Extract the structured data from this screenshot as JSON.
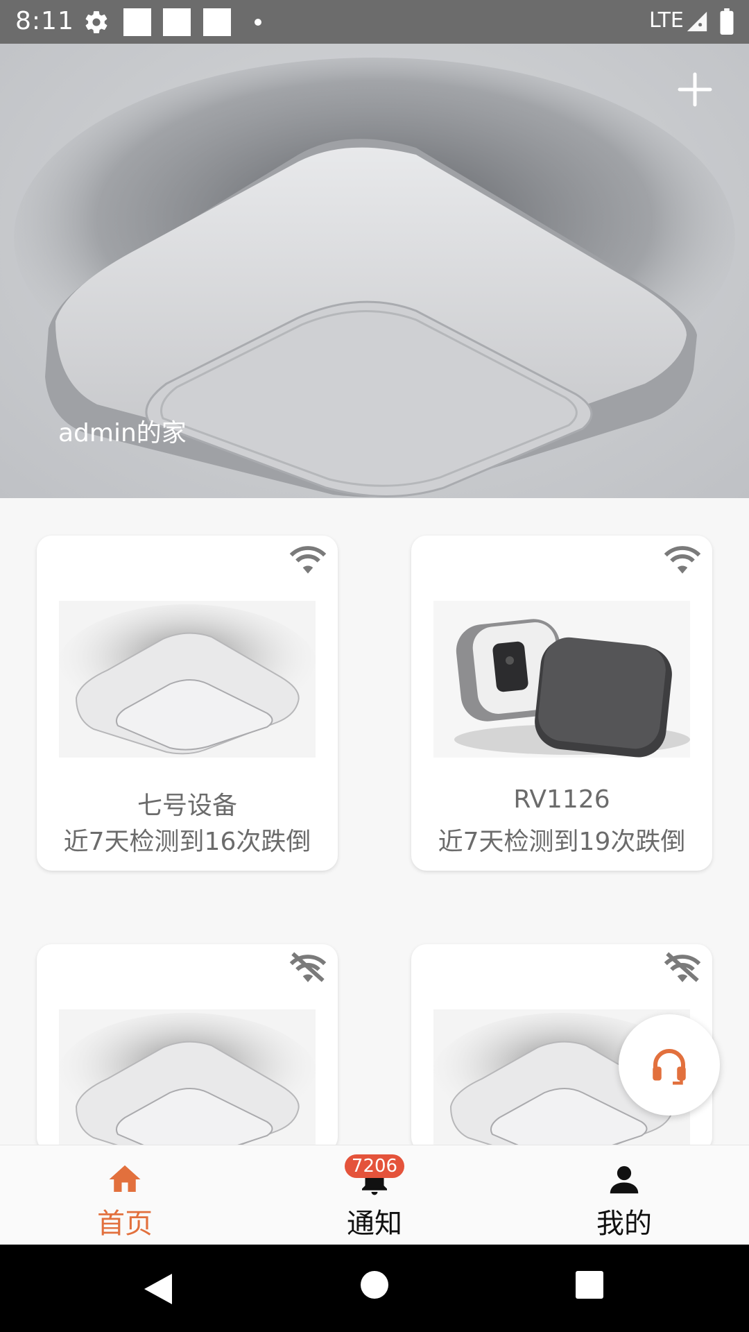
{
  "status_bar": {
    "time": "8:11",
    "network": "LTE",
    "icons": [
      "gear-icon",
      "notification-square-icon",
      "notification-square-icon",
      "notification-square-icon",
      "dot-icon",
      "signal-icon",
      "battery-icon"
    ]
  },
  "hero": {
    "home_title": "admin的家",
    "add_icon": "plus-icon"
  },
  "devices": [
    {
      "name": "七号设备",
      "stat": "近7天检测到16次跌倒",
      "wifi": "connected",
      "image": "ceiling-sensor"
    },
    {
      "name": "RV1126",
      "stat": "近7天检测到19次跌倒",
      "wifi": "connected",
      "image": "camera-device"
    },
    {
      "name": "",
      "stat": "",
      "wifi": "disconnected",
      "image": "ceiling-sensor"
    },
    {
      "name": "",
      "stat": "",
      "wifi": "disconnected",
      "image": "ceiling-sensor"
    }
  ],
  "fab": {
    "icon": "headset-icon"
  },
  "nav": {
    "home_label": "首页",
    "notify_label": "通知",
    "notify_badge": "7206",
    "mine_label": "我的"
  },
  "colors": {
    "accent": "#e2703d",
    "badge": "#e4533b",
    "status_bar": "#6c6c6c"
  }
}
